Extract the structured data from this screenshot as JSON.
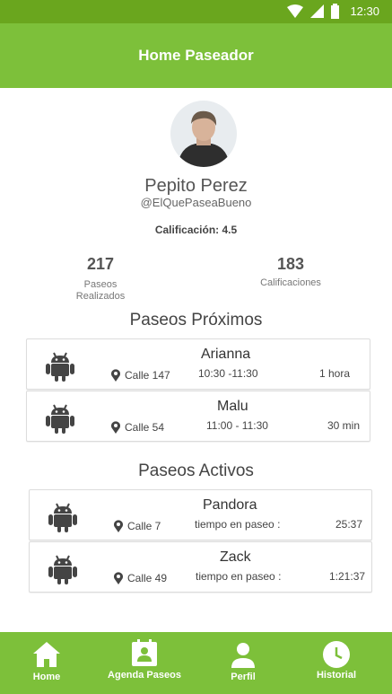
{
  "status_bar": {
    "time": "12:30"
  },
  "app_bar": {
    "title": "Home Paseador"
  },
  "profile": {
    "name": "Pepito Perez",
    "handle": "@ElQuePaseaBueno",
    "rating": "Calificación: 4.5",
    "stats": [
      {
        "value": "217",
        "label_line1": "Paseos",
        "label_line2": "Realizados"
      },
      {
        "value": "183",
        "label_line1": "Calificaciones",
        "label_line2": ""
      }
    ]
  },
  "upcoming": {
    "title": "Paseos Próximos",
    "items": [
      {
        "name": "Arianna",
        "street": "Calle 147",
        "time": "10:30 -11:30",
        "duration": "1 hora"
      },
      {
        "name": "Malu",
        "street": "Calle 54",
        "time": "11:00 - 11:30",
        "duration": "30 min"
      }
    ]
  },
  "active": {
    "title": "Paseos Activos",
    "items": [
      {
        "name": "Pandora",
        "street": "Calle 7",
        "time": "tiempo en paseo :",
        "duration": "25:37"
      },
      {
        "name": "Zack",
        "street": "Calle 49",
        "time": "tiempo en paseo :",
        "duration": "1:21:37"
      }
    ]
  },
  "bottom_nav": [
    {
      "label": "Home",
      "icon": "home-icon"
    },
    {
      "label": "Agenda Paseos",
      "icon": "calendar-person-icon"
    },
    {
      "label": "Perfil",
      "icon": "person-icon"
    },
    {
      "label": "Historial",
      "icon": "clock-icon"
    }
  ],
  "colors": {
    "primary": "#7dc03a",
    "status_bar": "#6aa61e",
    "icon_dark": "#444444"
  }
}
